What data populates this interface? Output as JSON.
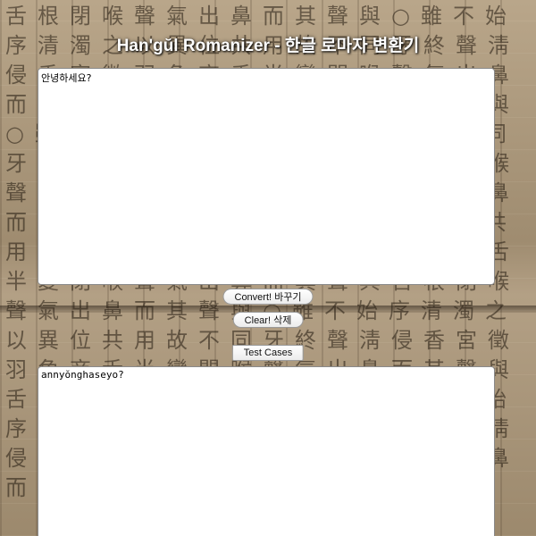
{
  "page": {
    "title": "Han'gŭl Romanizer - 한글 로마자 변환기"
  },
  "input": {
    "value": "안녕하세요?"
  },
  "buttons": {
    "convert_label": "Convert! 바꾸기",
    "clear_label": "Clear! 삭제",
    "test_cases_label": "Test Cases"
  },
  "output": {
    "value": "annyŏnghaseyo?"
  },
  "background": {
    "glyphs": "舌根閉喉聲氣出鼻而其聲與○雖不始序清濁之以異位共用故不同牙終聲淸侵香宮徵羽角商舌半變閉喉聲氣出鼻而其聲與舌根閉喉聲氣出鼻而其聲與○雖不始序清濁之以異位共用故不同牙終聲淸侵香宮徵羽角商舌半變閉喉聲氣出鼻而其聲與舌根閉喉聲氣出鼻而其聲與○雖不始序清濁之以異位共用故不同牙終聲淸侵香宮徵羽角商舌半變閉喉聲氣出鼻而其聲與舌根閉喉聲氣出鼻而其聲與○雖不始序清濁之以異位共用故不同牙終聲淸侵香宮徵羽角商舌半變閉喉聲氣出鼻而其聲與舌根閉喉聲氣出鼻而其聲與○雖不始序清濁之以異位共用故不同牙終聲淸侵香宮徵羽角商舌半變閉喉聲氣出鼻而其聲與"
  }
}
